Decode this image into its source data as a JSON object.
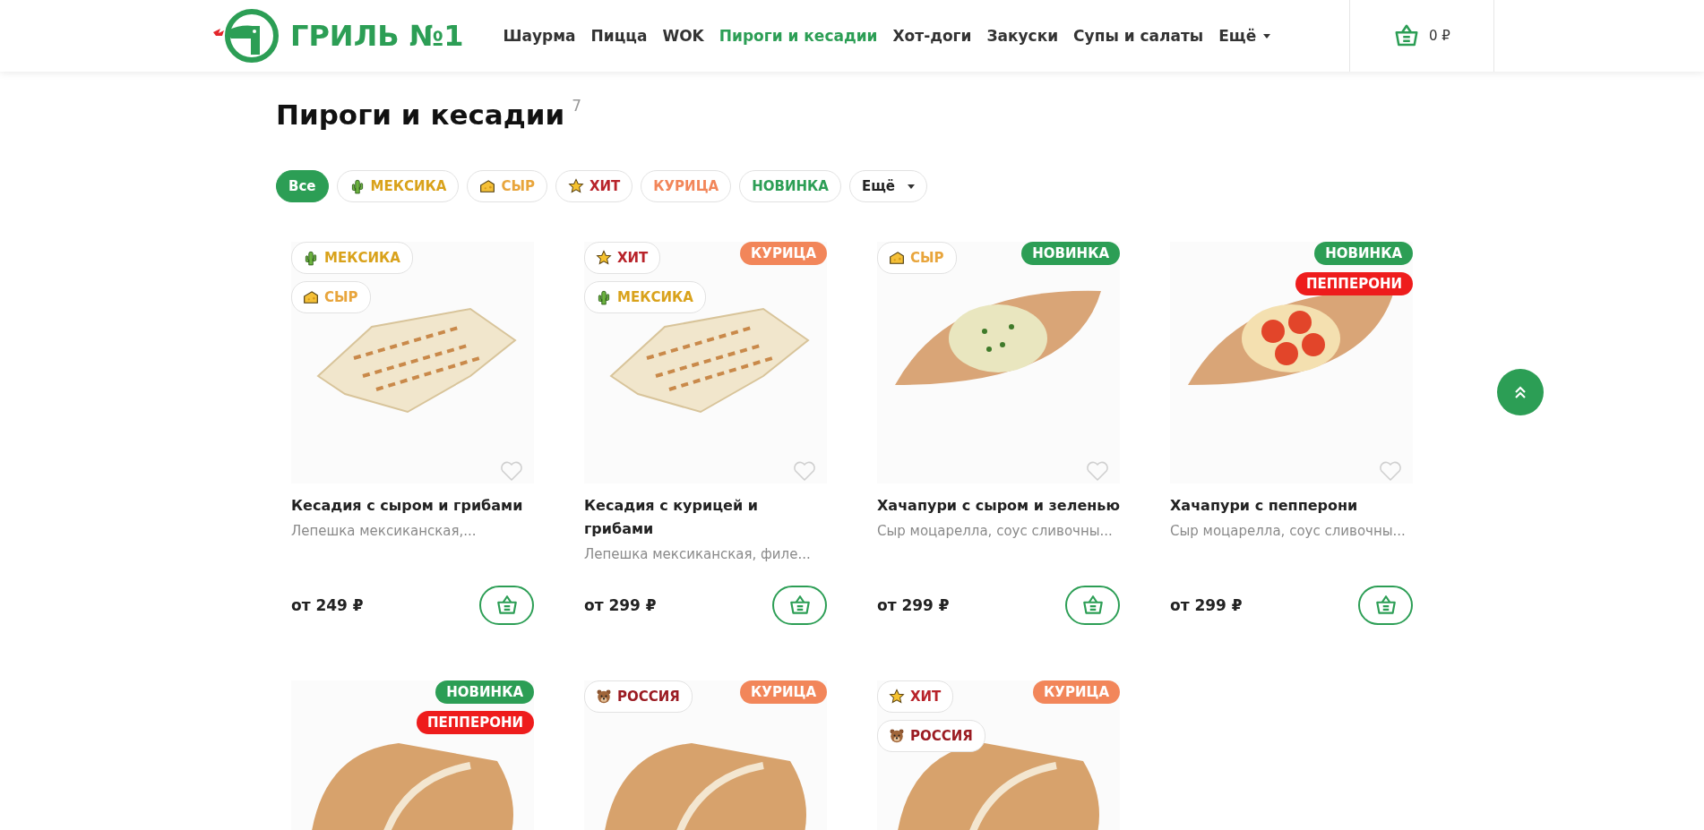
{
  "header": {
    "logo_text": "ГРИЛЬ №1",
    "nav": [
      {
        "label": "Шаурма",
        "selected": false
      },
      {
        "label": "Пицца",
        "selected": false
      },
      {
        "label": "WOK",
        "selected": false
      },
      {
        "label": "Пироги и кесадии",
        "selected": true
      },
      {
        "label": "Хот-доги",
        "selected": false
      },
      {
        "label": "Закуски",
        "selected": false
      },
      {
        "label": "Супы и салаты",
        "selected": false
      },
      {
        "label": "Ещё",
        "selected": false,
        "kind": "more"
      }
    ],
    "cart_total": "0 ₽"
  },
  "page": {
    "title": "Пироги и кесадии",
    "count": "7"
  },
  "filters": [
    {
      "label": "Все",
      "kind": "all",
      "selected": true
    },
    {
      "label": "МЕКСИКА",
      "kind": "mexico",
      "selected": false
    },
    {
      "label": "СЫР",
      "kind": "cheese",
      "selected": false
    },
    {
      "label": "ХИТ",
      "kind": "hit",
      "selected": false
    },
    {
      "label": "КУРИЦА",
      "kind": "chicken",
      "selected": false
    },
    {
      "label": "НОВИНКА",
      "kind": "new",
      "selected": false
    },
    {
      "label": "Ещё",
      "kind": "more",
      "selected": false
    }
  ],
  "products": [
    {
      "kind": "quesadilla",
      "left_tags": [
        {
          "label": "МЕКСИКА",
          "kind": "mexico"
        },
        {
          "label": "СЫР",
          "kind": "cheese"
        }
      ],
      "name": "Кесадия с сыром и грибами",
      "description": "Лепешка мексиканская,...",
      "price": "от 249 ₽"
    },
    {
      "kind": "quesadilla",
      "left_tags": [
        {
          "label": "ХИТ",
          "kind": "hit"
        },
        {
          "label": "МЕКСИКА",
          "kind": "mexico"
        }
      ],
      "right_tags": [
        {
          "label": "КУРИЦА",
          "kind": "chicken"
        }
      ],
      "name": "Кесадия с курицей и грибами",
      "description": "Лепешка мексиканская, филе...",
      "price": "от 299 ₽"
    },
    {
      "kind": "khachapuri",
      "left_tags": [
        {
          "label": "СЫР",
          "kind": "cheese"
        }
      ],
      "right_tags": [
        {
          "label": "НОВИНКА",
          "kind": "new"
        }
      ],
      "name": "Хачапури с сыром и зеленью",
      "description": "Сыр моцарелла, соус сливочны...",
      "price": "от 299 ₽"
    },
    {
      "kind": "pepperoni",
      "right_tags": [
        {
          "label": "НОВИНКА",
          "kind": "new"
        },
        {
          "label": "ПЕППЕРОНИ",
          "kind": "pepperoni"
        }
      ],
      "name": "Хачапури с пепперони",
      "description": "Сыр моцарелла, соус сливочны...",
      "price": "от 299 ₽"
    },
    {
      "kind": "pie",
      "right_tags": [
        {
          "label": "НОВИНКА",
          "kind": "new"
        },
        {
          "label": "ПЕППЕРОНИ",
          "kind": "pepperoni"
        }
      ]
    },
    {
      "kind": "pie",
      "left_tags": [
        {
          "label": "РОССИЯ",
          "kind": "russia"
        }
      ],
      "right_tags": [
        {
          "label": "КУРИЦА",
          "kind": "chicken"
        }
      ]
    },
    {
      "kind": "pie",
      "left_tags": [
        {
          "label": "ХИТ",
          "kind": "hit"
        },
        {
          "label": "РОССИЯ",
          "kind": "russia"
        }
      ],
      "right_tags": [
        {
          "label": "КУРИЦА",
          "kind": "chicken"
        }
      ]
    }
  ]
}
